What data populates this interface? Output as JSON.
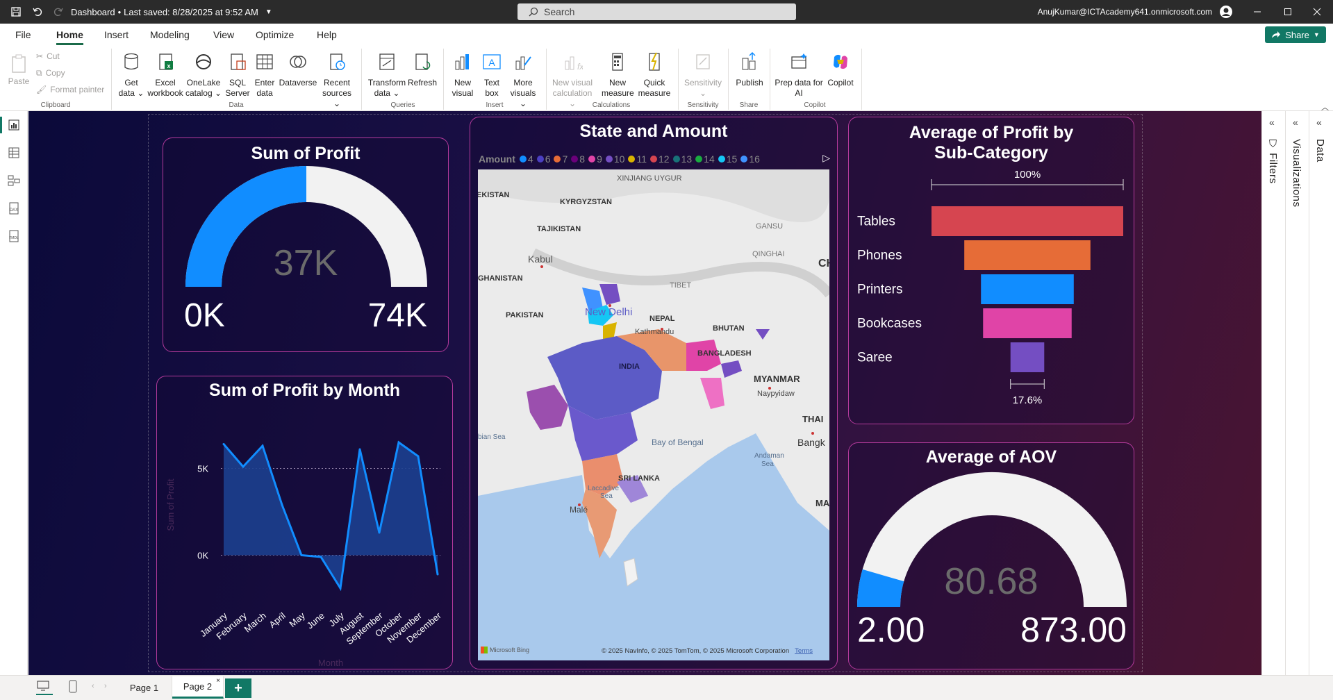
{
  "titlebar": {
    "doc_title": "Dashboard",
    "saved": "Last saved: 8/28/2025 at 9:52 AM",
    "search_placeholder": "Search",
    "user": "AnujKumar@ICTAcademy641.onmicrosoft.com"
  },
  "menu": {
    "tabs": [
      "File",
      "Home",
      "Insert",
      "Modeling",
      "View",
      "Optimize",
      "Help"
    ],
    "active": "Home",
    "share": "Share"
  },
  "ribbon": {
    "clipboard": {
      "paste": "Paste",
      "cut": "Cut",
      "copy": "Copy",
      "format_painter": "Format painter",
      "label": "Clipboard"
    },
    "data": {
      "get_data": [
        "Get",
        "data"
      ],
      "excel": [
        "Excel",
        "workbook"
      ],
      "onelake": [
        "OneLake",
        "catalog"
      ],
      "sql": [
        "SQL",
        "Server"
      ],
      "enter": [
        "Enter",
        "data"
      ],
      "dataverse": "Dataverse",
      "recent": [
        "Recent",
        "sources"
      ],
      "label": "Data"
    },
    "queries": {
      "transform": [
        "Transform",
        "data"
      ],
      "refresh": "Refresh",
      "label": "Queries"
    },
    "insert": {
      "new_visual": [
        "New",
        "visual"
      ],
      "text_box": [
        "Text",
        "box"
      ],
      "more_visuals": [
        "More",
        "visuals"
      ],
      "label": "Insert"
    },
    "calculations": {
      "new_visual_calc": [
        "New visual",
        "calculation"
      ],
      "new_measure": [
        "New",
        "measure"
      ],
      "quick_measure": [
        "Quick",
        "measure"
      ],
      "label": "Calculations"
    },
    "sensitivity": {
      "btn": "Sensitivity",
      "label": "Sensitivity"
    },
    "share": {
      "publish": "Publish",
      "label": "Share"
    },
    "copilot": {
      "prep": [
        "Prep data for",
        "AI"
      ],
      "copilot": "Copilot",
      "label": "Copilot"
    }
  },
  "right_panes": {
    "filters": "Filters",
    "visualizations": "Visualizations",
    "data": "Data"
  },
  "pages": {
    "page1": "Page 1",
    "page2": "Page 2",
    "active": "Page 2"
  },
  "visuals": {
    "sum_profit": {
      "title": "Sum of Profit",
      "value": "37K",
      "min": "0K",
      "max": "74K",
      "fill_fraction": 0.5
    },
    "avg_aov": {
      "title": "Average of AOV",
      "value": "80.68",
      "min": "2.00",
      "max": "873.00",
      "fill_fraction": 0.09
    },
    "map": {
      "title": "State and Amount",
      "legend_title": "Amount",
      "legend": [
        {
          "label": "4",
          "color": "#118dff"
        },
        {
          "label": "6",
          "color": "#4b3fc1"
        },
        {
          "label": "7",
          "color": "#e66c37"
        },
        {
          "label": "8",
          "color": "#6b007b"
        },
        {
          "label": "9",
          "color": "#e044a7"
        },
        {
          "label": "10",
          "color": "#744ec2"
        },
        {
          "label": "11",
          "color": "#d9b300"
        },
        {
          "label": "12",
          "color": "#d64550"
        },
        {
          "label": "13",
          "color": "#197278"
        },
        {
          "label": "14",
          "color": "#1aab40"
        },
        {
          "label": "15",
          "color": "#15c6f4"
        },
        {
          "label": "16",
          "color": "#4092ff"
        }
      ],
      "places": {
        "xinjiang": "XINJIANG UYGUR",
        "kyrgyzstan": "KYRGYZSTAN",
        "tajikistan": "TAJIKISTAN",
        "kabul": "Kabul",
        "afghanistan": "GHANISTAN",
        "pakistan": "PAKISTAN",
        "gansu": "GANSU",
        "qinghai": "QINGHAI",
        "tibet": "TIBET",
        "nepal": "NEPAL",
        "kathmandu": "Kathmandu",
        "bhutan": "BHUTAN",
        "bangladesh": "BANGLADESH",
        "india": "INDIA",
        "new_delhi": "New Delhi",
        "myanmar": "MYANMAR",
        "naypyidaw": "Naypyidaw",
        "thai": "THAI",
        "bangk": "Bangk",
        "bay_bengal": "Bay of Bengal",
        "andaman": "Andaman",
        "andaman_sea": "Sea",
        "arabian_sea": "bian Sea",
        "sri_lanka": "SRI LANKA",
        "laccadive": "Laccadive",
        "laccadive_sea": "Sea",
        "male": "Malé",
        "kistan": "EKISTAN",
        "ch": "CH",
        "ma": "MA"
      },
      "attribution": "© 2025 NavInfo, © 2025 TomTom, © 2025 Microsoft Corporation",
      "terms": "Terms",
      "bing": "Microsoft Bing"
    },
    "funnel": {
      "title_line1": "Average of Profit by",
      "title_line2": "Sub-Category",
      "top_label": "100%",
      "bottom_label": "17.6%"
    },
    "line": {
      "title": "Sum of Profit by Month",
      "xlabel": "Month",
      "ylabel": "Sum of Profit"
    }
  },
  "chart_data": [
    {
      "type": "bar",
      "title": "Average of Profit by Sub-Category",
      "categories": [
        "Tables",
        "Phones",
        "Printers",
        "Bookcases",
        "Saree"
      ],
      "values": [
        100,
        65.8,
        48.4,
        46.2,
        17.6
      ],
      "colors": [
        "#d64550",
        "#e66c37",
        "#118dff",
        "#e044a7",
        "#744ec2"
      ],
      "unit": "%"
    },
    {
      "type": "area",
      "title": "Sum of Profit by Month",
      "xlabel": "Month",
      "ylabel": "Sum of Profit",
      "categories": [
        "January",
        "February",
        "March",
        "April",
        "May",
        "June",
        "July",
        "August",
        "September",
        "October",
        "November",
        "December"
      ],
      "values": [
        6400,
        5100,
        6300,
        2900,
        0,
        -100,
        -1900,
        6100,
        1300,
        6500,
        5700,
        -1100
      ],
      "yticks": [
        "0K",
        "5K"
      ],
      "ylim": [
        -2500,
        7500
      ],
      "color": "#118dff"
    }
  ]
}
